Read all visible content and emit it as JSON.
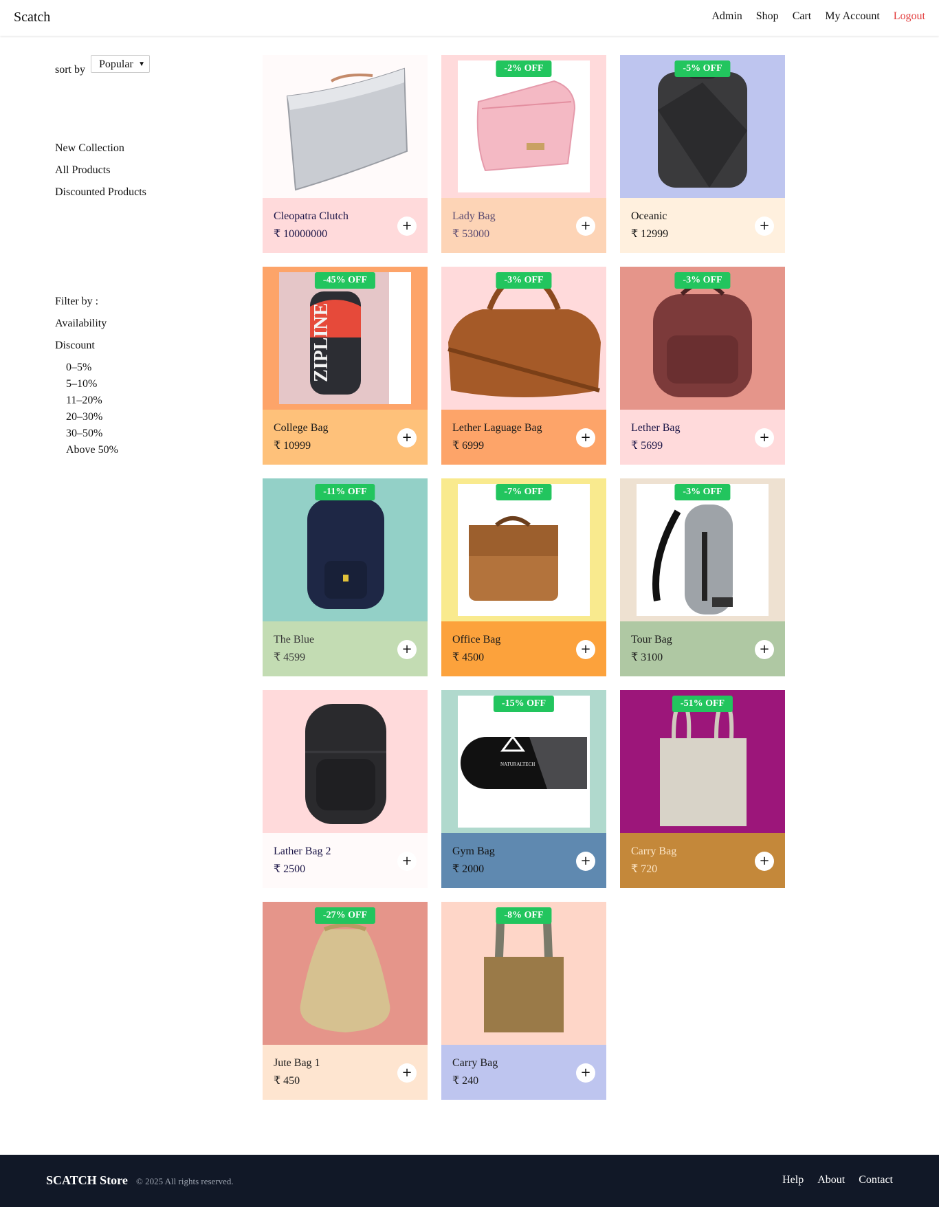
{
  "header": {
    "brand": "Scatch",
    "nav": [
      "Admin",
      "Shop",
      "Cart",
      "My Account",
      "Logout"
    ]
  },
  "sidebar": {
    "sort_label": "sort by",
    "sort_value": "Popular",
    "links": [
      "New Collection",
      "All Products",
      "Discounted Products"
    ],
    "filter_label": "Filter by :",
    "availability_label": "Availability",
    "discount_label": "Discount",
    "discount_ranges": [
      "0–5%",
      "5–10%",
      "11–20%",
      "20–30%",
      "30–50%",
      "Above 50%"
    ]
  },
  "products": [
    {
      "name": "Cleopatra Clutch",
      "price": "₹ 10000000",
      "discount": "",
      "bg": "#fffafa",
      "panel": "#ffdadb",
      "text": "#1a1446",
      "icon": "clutch-icon"
    },
    {
      "name": "Lady Bag",
      "price": "₹ 53000",
      "discount": "-2% OFF",
      "bg": "#ffdadb",
      "panel": "#fdd4b6",
      "text": "#5a4a70",
      "icon": "pouch-icon"
    },
    {
      "name": "Oceanic",
      "price": "₹ 12999",
      "discount": "-5% OFF",
      "bg": "#bec5ef",
      "panel": "#fff0de",
      "text": "#111111",
      "icon": "backpack-icon"
    },
    {
      "name": "College Bag",
      "price": "₹ 10999",
      "discount": "-45% OFF",
      "bg": "#fda469",
      "panel": "#fec17a",
      "text": "#1a1a1a",
      "icon": "backpack-icon"
    },
    {
      "name": "Lether Laguage Bag",
      "price": "₹ 6999",
      "discount": "-3% OFF",
      "bg": "#ffdadb",
      "panel": "#fda469",
      "text": "#1a1a1a",
      "icon": "duffel-icon"
    },
    {
      "name": "Lether Bag",
      "price": "₹ 5699",
      "discount": "-3% OFF",
      "bg": "#e5958a",
      "panel": "#ffdadb",
      "text": "#1a1446",
      "icon": "backpack-icon"
    },
    {
      "name": "The Blue",
      "price": "₹ 4599",
      "discount": "-11% OFF",
      "bg": "#93d0c7",
      "panel": "#c3dcb3",
      "text": "#3a3a3a",
      "icon": "backpack-icon"
    },
    {
      "name": "Office Bag",
      "price": "₹ 4500",
      "discount": "-7% OFF",
      "bg": "#f9ea8e",
      "panel": "#fca23c",
      "text": "#1a1a1a",
      "icon": "briefcase-icon"
    },
    {
      "name": "Tour Bag",
      "price": "₹ 3100",
      "discount": "-3% OFF",
      "bg": "#eee1d1",
      "panel": "#afc8a3",
      "text": "#1a1a1a",
      "icon": "sling-bag-icon"
    },
    {
      "name": "Lather Bag 2",
      "price": "₹ 2500",
      "discount": "",
      "bg": "#ffdadb",
      "panel": "#fffafa",
      "text": "#1a1446",
      "icon": "backpack-icon"
    },
    {
      "name": "Gym Bag",
      "price": "₹ 2000",
      "discount": "-15% OFF",
      "bg": "#b0d9cd",
      "panel": "#5f89b0",
      "text": "#111111",
      "icon": "duffel-icon"
    },
    {
      "name": "Carry Bag",
      "price": "₹ 720",
      "discount": "-51% OFF",
      "bg": "#9c167a",
      "panel": "#c4883a",
      "text": "#fde7c9",
      "icon": "tote-icon"
    },
    {
      "name": "Jute Bag 1",
      "price": "₹ 450",
      "discount": "-27% OFF",
      "bg": "#e5958a",
      "panel": "#fee5d0",
      "text": "#1a1a1a",
      "icon": "sack-icon"
    },
    {
      "name": "Carry Bag",
      "price": "₹ 240",
      "discount": "-8% OFF",
      "bg": "#fed6c8",
      "panel": "#bec5ef",
      "text": "#1a1a1a",
      "icon": "tote-icon"
    }
  ],
  "add_symbol": "+",
  "footer": {
    "brand": "SCATCH Store",
    "copyright": "© 2025 All rights reserved.",
    "links": [
      "Help",
      "About",
      "Contact"
    ]
  }
}
